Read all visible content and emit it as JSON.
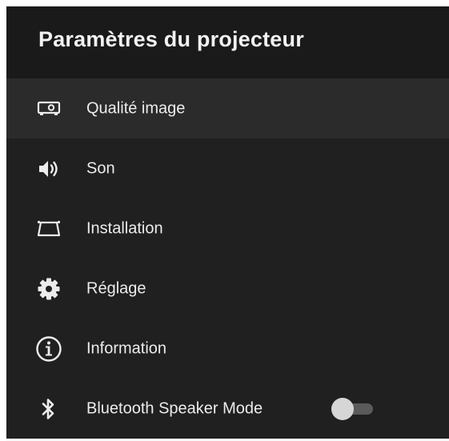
{
  "header": {
    "title": "Paramètres du projecteur"
  },
  "menu": {
    "items": [
      {
        "label": "Qualité image",
        "icon": "projector-icon",
        "selected": true
      },
      {
        "label": "Son",
        "icon": "speaker-icon",
        "selected": false
      },
      {
        "label": "Installation",
        "icon": "keystone-icon",
        "selected": false
      },
      {
        "label": "Réglage",
        "icon": "gear-icon",
        "selected": false
      },
      {
        "label": "Information",
        "icon": "info-icon",
        "selected": false
      },
      {
        "label": "Bluetooth Speaker Mode",
        "icon": "bluetooth-icon",
        "selected": false,
        "toggle": "off"
      }
    ]
  },
  "colors": {
    "background": "#202020",
    "header_background": "#1a1a1a",
    "selected_row": "#2b2b2b",
    "text": "#ececec",
    "toggle_track": "#5a5a5a",
    "toggle_knob": "#d6d6d6"
  }
}
